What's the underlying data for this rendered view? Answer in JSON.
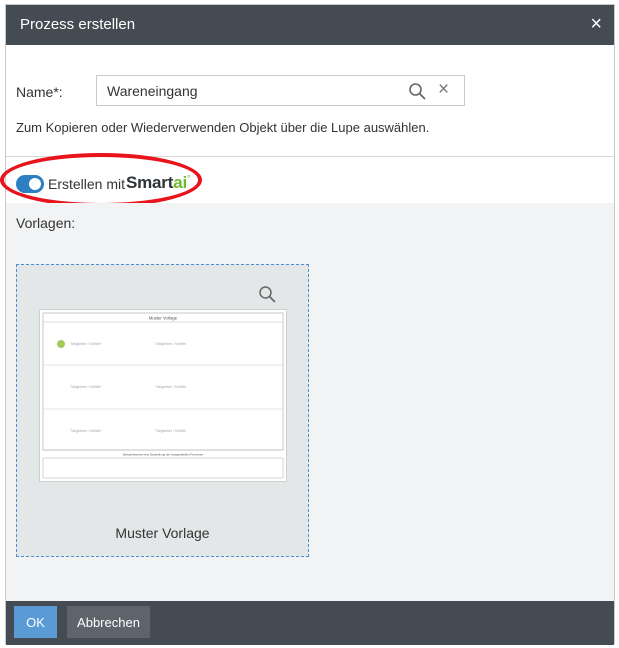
{
  "dialog": {
    "title": "Prozess erstellen",
    "close_icon": "×"
  },
  "form": {
    "name_label": "Name*:",
    "name_value": "Wareneingang",
    "search_icon": "magnifier-icon",
    "clear_icon": "×",
    "hint": "Zum Kopieren oder Wiederverwenden Objekt über die Lupe auswählen."
  },
  "smartai": {
    "toggle_on": true,
    "label": "Erstellen mit",
    "brand_main": "Smart",
    "brand_ai": "ai",
    "brand_sup": "°"
  },
  "templates": {
    "label": "Vorlagen:",
    "items": [
      {
        "name": "Muster Vorlage",
        "thumbnail": {
          "header": "Muster Vorlage",
          "cells": [
            "Tätigkeiten / Mithilfe",
            "Tätigkeiten / Mithilfe"
          ],
          "footer": "Beispielsweise eine Darstellung der ausgewählten Prozesse"
        }
      }
    ]
  },
  "footer": {
    "ok_label": "OK",
    "cancel_label": "Abbrechen"
  },
  "colors": {
    "titlebar": "#454b52",
    "accent": "#2c7fc1",
    "ok_button": "#5a9bd5",
    "highlight": "#e8131b",
    "brand_ai": "#6fb82d"
  }
}
